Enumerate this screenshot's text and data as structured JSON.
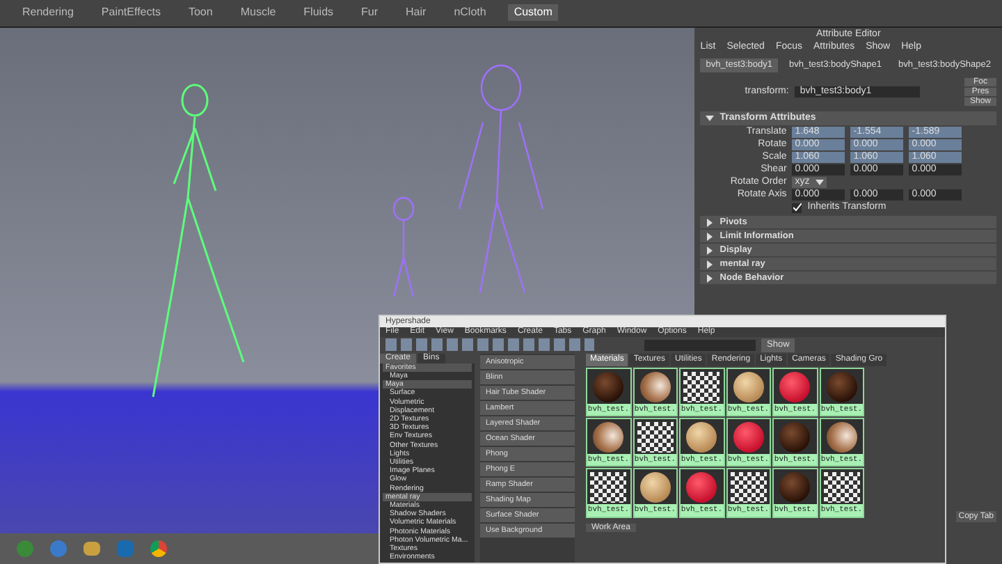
{
  "shelf_tabs": [
    {
      "label": "Rendering",
      "selected": false
    },
    {
      "label": "PaintEffects",
      "selected": false
    },
    {
      "label": "Toon",
      "selected": false
    },
    {
      "label": "Muscle",
      "selected": false
    },
    {
      "label": "Fluids",
      "selected": false
    },
    {
      "label": "Fur",
      "selected": false
    },
    {
      "label": "Hair",
      "selected": false
    },
    {
      "label": "nCloth",
      "selected": false
    },
    {
      "label": "Custom",
      "selected": true
    }
  ],
  "attribute_editor": {
    "title": "Attribute Editor",
    "menu": [
      "List",
      "Selected",
      "Focus",
      "Attributes",
      "Show",
      "Help"
    ],
    "tabs": [
      {
        "label": "bvh_test3:body1",
        "selected": true
      },
      {
        "label": "bvh_test3:bodyShape1",
        "selected": false
      },
      {
        "label": "bvh_test3:bodyShape2",
        "selected": false
      }
    ],
    "transform_label": "transform:",
    "transform_value": "bvh_test3:body1",
    "side_buttons": [
      "Foc",
      "Pres",
      "Show"
    ],
    "section_title": "Transform Attributes",
    "section_expanded": true,
    "rows": [
      {
        "kind": "vector",
        "label": "Translate",
        "keyed": true,
        "values": [
          "1.648",
          "-1.554",
          "-1.589"
        ]
      },
      {
        "kind": "vector",
        "label": "Rotate",
        "keyed": true,
        "values": [
          "0.000",
          "0.000",
          "0.000"
        ]
      },
      {
        "kind": "vector",
        "label": "Scale",
        "keyed": true,
        "values": [
          "1.060",
          "1.060",
          "1.060"
        ]
      },
      {
        "kind": "vector",
        "label": "Shear",
        "keyed": false,
        "values": [
          "0.000",
          "0.000",
          "0.000"
        ]
      },
      {
        "kind": "enum",
        "label": "Rotate Order",
        "value": "xyz"
      },
      {
        "kind": "vector",
        "label": "Rotate Axis",
        "keyed": false,
        "values": [
          "0.000",
          "0.000",
          "0.000"
        ]
      },
      {
        "kind": "checkbox",
        "label": "Inherits Transform",
        "checked": true
      }
    ],
    "sections": [
      {
        "title": "Pivots",
        "expanded": false
      },
      {
        "title": "Limit Information",
        "expanded": false
      },
      {
        "title": "Display",
        "expanded": false
      },
      {
        "title": "mental ray",
        "expanded": false
      },
      {
        "title": "Node Behavior",
        "expanded": false
      }
    ]
  },
  "hypershade": {
    "title": "Hypershade",
    "menu": [
      "File",
      "Edit",
      "View",
      "Bookmarks",
      "Create",
      "Tabs",
      "Graph",
      "Window",
      "Options",
      "Help"
    ],
    "show_button": "Show",
    "left_tabs": [
      {
        "label": "Create",
        "selected": true
      },
      {
        "label": "Bins",
        "selected": false
      }
    ],
    "tree": [
      {
        "label": "Favorites",
        "expanded": true,
        "children": [
          {
            "label": "Maya"
          }
        ]
      },
      {
        "label": "Maya",
        "expanded": true,
        "children": [
          {
            "label": "Surface"
          },
          {
            "label": "Volumetric"
          },
          {
            "label": "Displacement"
          },
          {
            "label": "2D Textures"
          },
          {
            "label": "3D Textures"
          },
          {
            "label": "Env Textures"
          },
          {
            "label": "Other Textures"
          },
          {
            "label": "Lights"
          },
          {
            "label": "Utilities"
          },
          {
            "label": "Image Planes"
          },
          {
            "label": "Glow"
          },
          {
            "label": "Rendering"
          }
        ]
      },
      {
        "label": "mental ray",
        "expanded": true,
        "children": [
          {
            "label": "Materials"
          },
          {
            "label": "Shadow Shaders"
          },
          {
            "label": "Volumetric Materials"
          },
          {
            "label": "Photonic Materials"
          },
          {
            "label": "Photon Volumetric Ma..."
          },
          {
            "label": "Textures"
          },
          {
            "label": "Environments"
          }
        ]
      }
    ],
    "nodes": [
      "Anisotropic",
      "Blinn",
      "Hair Tube Shader",
      "Lambert",
      "Layered Shader",
      "Ocean Shader",
      "Phong",
      "Phong E",
      "Ramp Shader",
      "Shading Map",
      "Surface Shader",
      "Use Background"
    ],
    "tabs": [
      {
        "label": "Materials",
        "selected": true
      },
      {
        "label": "Textures",
        "selected": false
      },
      {
        "label": "Utilities",
        "selected": false
      },
      {
        "label": "Rendering",
        "selected": false
      },
      {
        "label": "Lights",
        "selected": false
      },
      {
        "label": "Cameras",
        "selected": false
      },
      {
        "label": "Shading Gro",
        "selected": false
      }
    ],
    "swatches": [
      {
        "kind": "dark",
        "label": "bvh_test."
      },
      {
        "kind": "skin",
        "label": "bvh_test."
      },
      {
        "kind": "checker",
        "label": "bvh_test."
      },
      {
        "kind": "wood",
        "label": "bvh_test."
      },
      {
        "kind": "red",
        "label": "bvh_test."
      },
      {
        "kind": "dark",
        "label": "bvh_test."
      },
      {
        "kind": "skin",
        "label": "bvh_test."
      },
      {
        "kind": "checker",
        "label": "bvh_test."
      },
      {
        "kind": "wood",
        "label": "bvh_test."
      },
      {
        "kind": "red",
        "label": "bvh_test."
      },
      {
        "kind": "dark",
        "label": "bvh_test."
      },
      {
        "kind": "skin",
        "label": "bvh_test."
      },
      {
        "kind": "checker",
        "label": "bvh_test."
      },
      {
        "kind": "wood",
        "label": "bvh_test."
      },
      {
        "kind": "red",
        "label": "bvh_test."
      },
      {
        "kind": "checker",
        "label": "bvh_test."
      },
      {
        "kind": "dark",
        "label": "bvh_test."
      },
      {
        "kind": "checker",
        "label": "bvh_test."
      }
    ],
    "work_area": "Work Area"
  },
  "copy_tab": "Copy Tab"
}
